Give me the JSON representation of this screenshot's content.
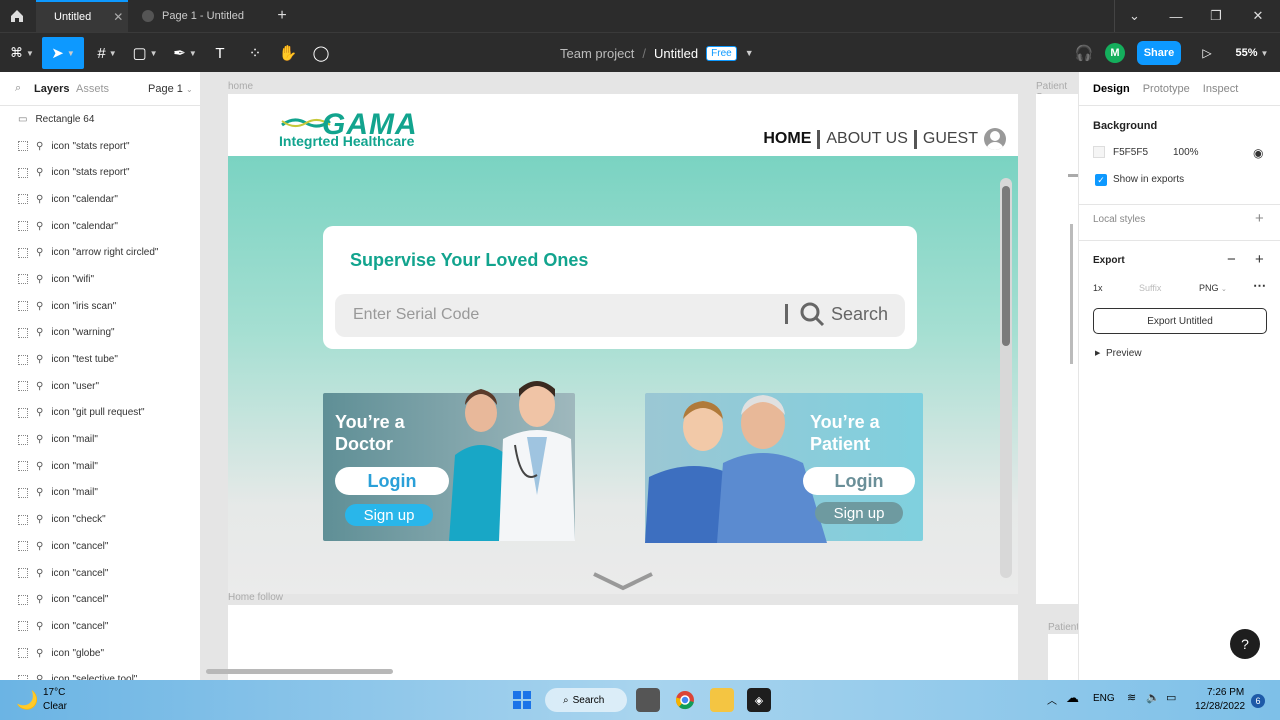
{
  "titlebar": {
    "tabs": [
      {
        "label": "Untitled",
        "active": true
      },
      {
        "label": "Page 1 - Untitled",
        "active": false
      }
    ],
    "new_tab": "+"
  },
  "toolbar": {
    "team": "Team project",
    "slash": "/",
    "file": "Untitled",
    "plan_badge": "Free",
    "avatar_initial": "M",
    "share_label": "Share",
    "zoom": "55%"
  },
  "leftpanel": {
    "tabs": [
      "Layers",
      "Assets"
    ],
    "page_select": "Page 1",
    "layers": [
      "Rectangle 64",
      "icon \"stats report\"",
      "icon \"stats report\"",
      "icon \"calendar\"",
      "icon \"calendar\"",
      "icon \"arrow right circled\"",
      "icon \"wifi\"",
      "icon \"iris scan\"",
      "icon \"warning\"",
      "icon \"test tube\"",
      "icon \"user\"",
      "icon \"git pull request\"",
      "icon \"mail\"",
      "icon \"mail\"",
      "icon \"mail\"",
      "icon \"check\"",
      "icon \"cancel\"",
      "icon \"cancel\"",
      "icon \"cancel\"",
      "icon \"cancel\"",
      "icon \"globe\"",
      "icon \"selective tool\""
    ]
  },
  "canvas": {
    "frame_home_label": "home",
    "frame_patient_label": "Patient Se",
    "frame_follow_label": "Home follow",
    "frame_patient2_label": "Patient",
    "logo_main": "GAMA",
    "logo_sub": "Integrted Healthcare",
    "nav": {
      "home": "HOME",
      "about": "ABOUT US",
      "guest": "GUEST"
    },
    "search_title": "Supervise Your Loved Ones",
    "search_placeholder": "Enter Serial Code",
    "search_button": "Search",
    "doctor_title_1": "You’re a",
    "doctor_title_2": "Doctor",
    "patient_title_1": "You’re a",
    "patient_title_2": "Patient",
    "login_label": "Login",
    "signup_label": "Sign up"
  },
  "rightpanel": {
    "tabs": [
      "Design",
      "Prototype",
      "Inspect"
    ],
    "background_label": "Background",
    "bg_hex": "F5F5F5",
    "bg_opacity": "100%",
    "show_in_exports": "Show in exports",
    "local_styles": "Local styles",
    "export_label": "Export",
    "export_scale": "1x",
    "export_suffix_placeholder": "Suffix",
    "export_format": "PNG",
    "export_button": "Export Untitled",
    "preview_label": "Preview",
    "help": "?"
  },
  "taskbar": {
    "temp": "17°C",
    "weather": "Clear",
    "search": "Search",
    "lang": "ENG",
    "time": "7:26 PM",
    "date": "12/28/2022",
    "notif_count": "6"
  },
  "colors": {
    "accent": "#0d99ff",
    "brand_teal": "#12a48e",
    "chrome_dark": "#2c2c2c"
  }
}
